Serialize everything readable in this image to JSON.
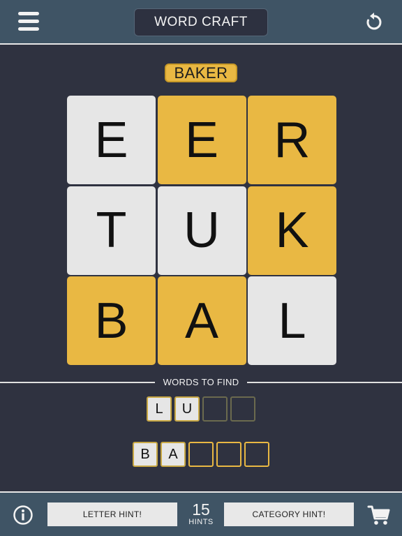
{
  "header": {
    "title": "WORD CRAFT",
    "menu_icon": "hamburger-menu-icon",
    "reset_icon": "reset-icon"
  },
  "target_word": "BAKER",
  "grid": {
    "tiles": [
      {
        "letter": "E",
        "color": "gray"
      },
      {
        "letter": "E",
        "color": "yellow"
      },
      {
        "letter": "R",
        "color": "yellow"
      },
      {
        "letter": "T",
        "color": "gray"
      },
      {
        "letter": "U",
        "color": "gray"
      },
      {
        "letter": "K",
        "color": "yellow"
      },
      {
        "letter": "B",
        "color": "yellow"
      },
      {
        "letter": "A",
        "color": "yellow"
      },
      {
        "letter": "L",
        "color": "gray"
      }
    ]
  },
  "words_to_find": {
    "label": "WORDS TO FIND",
    "words": [
      {
        "slots": [
          "L",
          "U",
          "",
          ""
        ],
        "style": "gray"
      },
      {
        "slots": [
          "B",
          "A",
          "",
          "",
          ""
        ],
        "style": "yellow"
      }
    ]
  },
  "footer": {
    "info_icon": "info-icon",
    "letter_hint_label": "LETTER HINT!",
    "hints_count": "15",
    "hints_label": "HINTS",
    "category_hint_label": "CATEGORY HINT!",
    "cart_icon": "shopping-cart-icon"
  },
  "colors": {
    "background": "#2f3240",
    "bar": "#3f5465",
    "tile_yellow": "#e9b843",
    "tile_gray": "#e6e6e6"
  }
}
